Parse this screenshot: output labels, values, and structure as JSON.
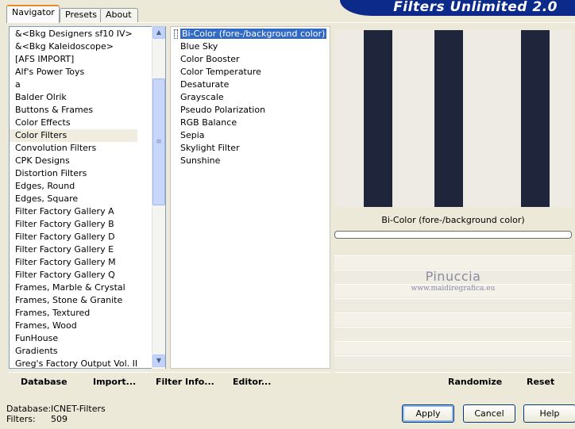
{
  "tabs": [
    {
      "label": "Navigator",
      "active": true
    },
    {
      "label": "Presets",
      "active": false
    },
    {
      "label": "About",
      "active": false
    }
  ],
  "banner": {
    "title": "Filters Unlimited 2.0"
  },
  "categories": {
    "items": [
      "&<Bkg Designers sf10 IV>",
      "&<Bkg Kaleidoscope>",
      "[AFS IMPORT]",
      "Alf's Power Toys",
      "a",
      "Balder Olrik",
      "Buttons & Frames",
      "Color Effects",
      "Color Filters",
      "Convolution Filters",
      "CPK Designs",
      "Distortion Filters",
      "Edges, Round",
      "Edges, Square",
      "Filter Factory Gallery A",
      "Filter Factory Gallery B",
      "Filter Factory Gallery D",
      "Filter Factory Gallery E",
      "Filter Factory Gallery M",
      "Filter Factory Gallery Q",
      "Frames, Marble & Crystal",
      "Frames, Stone & Granite",
      "Frames, Textured",
      "Frames, Wood",
      "FunHouse",
      "Gradients",
      "Greg's Factory Output Vol. II"
    ],
    "selected_index": 8
  },
  "filters": {
    "items": [
      "Bi-Color (fore-/background color)",
      "Blue Sky",
      "Color Booster",
      "Color Temperature",
      "Desaturate",
      "Grayscale",
      "Pseudo Polarization",
      "RGB Balance",
      "Sepia",
      "Skylight Filter",
      "Sunshine"
    ],
    "selected_index": 0
  },
  "preview": {
    "filter_name": "Bi-Color (fore-/background color)",
    "colors": {
      "background": "#eeebe5",
      "stripe": "#1f263b"
    }
  },
  "watermark": {
    "name": "Pinuccia",
    "url": "www.maidiregrafica.eu"
  },
  "left_actions": {
    "database": "Database",
    "import": "Import...",
    "filter_info": "Filter Info...",
    "editor": "Editor..."
  },
  "right_actions": {
    "randomize": "Randomize",
    "reset": "Reset"
  },
  "info": {
    "database_label": "Database:",
    "database_value": "ICNET-Filters",
    "filters_label": "Filters:",
    "filters_value": "509"
  },
  "buttons": {
    "apply": "Apply",
    "cancel": "Cancel",
    "help": "Help"
  },
  "colors": {
    "accent": "#0b2a8a",
    "selection": "#316ac5"
  }
}
